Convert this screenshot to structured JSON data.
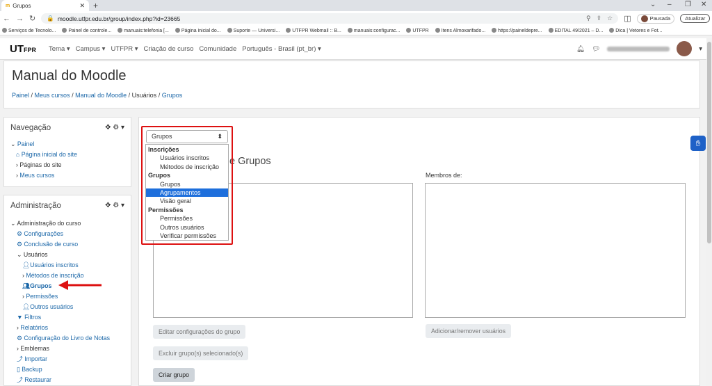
{
  "browser": {
    "tab_title": "Grupos",
    "url": "moodle.utfpr.edu.br/group/index.php?id=23665",
    "profile_status": "Pausada",
    "update_label": "Atualizar",
    "bookmarks": [
      "Serviços de Tecnolo...",
      "Painel de controle...",
      "manuais:telefonia [...",
      "Página inicial do...",
      "Suporte — Universi...",
      "UTFPR Webmail :: B...",
      "manuais:configurac...",
      "UTFPR",
      "Itens Almoxarifado...",
      "https://paineldepre...",
      "EDITAL 49/2021 – D...",
      "Dica | Vetores e Fot..."
    ]
  },
  "moodle_nav": {
    "logo_main": "UT",
    "logo_sub": "FPR",
    "items": [
      "Tema",
      "Campus",
      "UTFPR",
      "Criação de curso",
      "Comunidade",
      "Português - Brasil (pt_br)"
    ]
  },
  "header": {
    "title": "Manual do Moodle",
    "breadcrumb": [
      "Painel",
      "Meus cursos",
      "Manual do Moodle",
      "Usuários",
      "Grupos"
    ]
  },
  "navigation_block": {
    "title": "Navegação",
    "items": [
      "Painel",
      "Página inicial do site",
      "Páginas do site",
      "Meus cursos"
    ]
  },
  "admin_block": {
    "title": "Administração",
    "items": [
      "Administração do curso",
      "Configurações",
      "Conclusão de curso",
      "Usuários",
      "Usuários inscritos",
      "Métodos de inscrição",
      "Grupos",
      "Permissões",
      "Outros usuários",
      "Filtros",
      "Relatórios",
      "Configuração do Livro de Notas",
      "Emblemas",
      "Importar",
      "Backup",
      "Restaurar"
    ]
  },
  "main": {
    "select_value": "Grupos",
    "dropdown": {
      "group1": "Inscrições",
      "g1_opts": [
        "Usuários inscritos",
        "Métodos de inscrição"
      ],
      "group2": "Grupos",
      "g2_opts": [
        "Grupos",
        "Agrupamentos",
        "Visão geral"
      ],
      "group3": "Permissões",
      "g3_opts": [
        "Permissões",
        "Outros usuários",
        "Verificar permissões"
      ]
    },
    "section_title": "e Grupos",
    "members_label": "Membros de:",
    "buttons": {
      "edit": "Editar configurações do grupo",
      "add_remove": "Adicionar/remover usuários",
      "delete": "Excluir grupo(s) selecionado(s)",
      "create": "Criar grupo"
    }
  },
  "colors": {
    "link": "#1b67a8",
    "highlight": "#1e6fdc",
    "annotation": "#dd1111"
  }
}
